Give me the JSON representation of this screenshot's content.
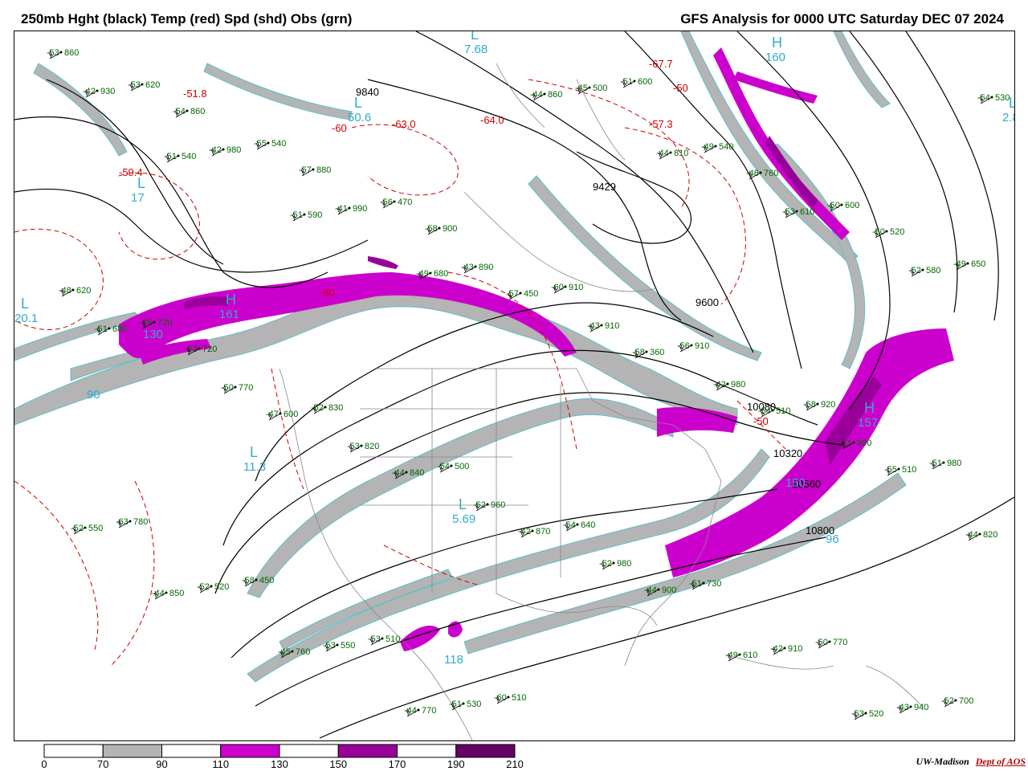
{
  "header": {
    "title_left": "250mb Hght (black) Temp (red) Spd (shd) Obs (grn)",
    "title_right": "GFS Analysis for 0000 UTC Saturday  DEC 07 2024"
  },
  "colors": {
    "gray_70_90": "#b4b4b4",
    "magenta_110_130": "#cc00cc",
    "purple_150_170": "#990099",
    "darkpurple_190_210": "#660066",
    "height_contour": "#000000",
    "temp_contour": "#cc0000",
    "obs": "#006600",
    "extrema": "#33aacc"
  },
  "colorbar": {
    "ticks": [
      "0",
      "70",
      "90",
      "110",
      "130",
      "150",
      "170",
      "190",
      "210"
    ],
    "fills": [
      "#ffffff",
      "#b4b4b4",
      "#ffffff",
      "#cc00cc",
      "#ffffff",
      "#990099",
      "#ffffff",
      "#660066"
    ]
  },
  "map": {
    "height_labels": [
      "9840",
      "9429",
      "9600",
      "10080",
      "10320",
      "10560",
      "10800"
    ],
    "temp_labels": [
      "-50",
      "-60",
      "-63.0",
      "-64.0",
      "-57.3",
      "-67.7",
      "-51.8",
      "-59.4",
      "-60",
      "-50"
    ],
    "extrema": [
      {
        "letter": "H",
        "value": "161"
      },
      {
        "letter": "H",
        "value": "157"
      },
      {
        "letter": "H",
        "value": "160"
      },
      {
        "letter": "L",
        "value": "7.68"
      },
      {
        "letter": "L",
        "value": "20.1"
      },
      {
        "letter": "L",
        "value": "11.3"
      },
      {
        "letter": "L",
        "value": "5.69"
      },
      {
        "letter": "L",
        "value": "2.8"
      },
      {
        "letter": "L",
        "value": "50.6"
      },
      {
        "letter": "L",
        "value": "17"
      },
      {
        "letter": "",
        "value": "90"
      },
      {
        "letter": "",
        "value": "130"
      },
      {
        "letter": "",
        "value": "150"
      },
      {
        "letter": "",
        "value": "118"
      },
      {
        "letter": "",
        "value": "96"
      }
    ],
    "obs": [
      {
        "t": "-53",
        "h": "860"
      },
      {
        "t": "-54",
        "h": "860"
      },
      {
        "t": "-57",
        "h": "880"
      },
      {
        "t": "-58",
        "h": "900"
      },
      {
        "t": "-60",
        "h": "910"
      },
      {
        "t": "-56",
        "h": "910"
      },
      {
        "t": "-58",
        "h": "920"
      },
      {
        "t": "-51",
        "h": "980"
      },
      {
        "t": "-63",
        "h": "780"
      },
      {
        "t": "-58",
        "h": "450"
      },
      {
        "t": "-53",
        "h": "510"
      },
      {
        "t": "-60",
        "h": "510"
      },
      {
        "t": "-51",
        "h": "600"
      },
      {
        "t": "-48",
        "h": "760"
      },
      {
        "t": "-50",
        "h": "520"
      },
      {
        "t": "-48",
        "h": "620"
      },
      {
        "t": "-53",
        "h": "720"
      },
      {
        "t": "-52",
        "h": "830"
      },
      {
        "t": "-54",
        "h": "500"
      },
      {
        "t": "-54",
        "h": "640"
      },
      {
        "t": "-51",
        "h": "730"
      },
      {
        "t": "-50",
        "h": "770"
      },
      {
        "t": "-52",
        "h": "700"
      },
      {
        "t": "-53",
        "h": "620"
      },
      {
        "t": "-55",
        "h": "540"
      },
      {
        "t": "-56",
        "h": "470"
      },
      {
        "t": "-57",
        "h": "450"
      },
      {
        "t": "-58",
        "h": "360"
      },
      {
        "t": "-54",
        "h": "510"
      },
      {
        "t": "-55",
        "h": "510"
      },
      {
        "t": "-52",
        "h": "550"
      },
      {
        "t": "-52",
        "h": "520"
      },
      {
        "t": "-53",
        "h": "550"
      },
      {
        "t": "-51",
        "h": "530"
      },
      {
        "t": "-45",
        "h": "500"
      },
      {
        "t": "-49",
        "h": "540"
      },
      {
        "t": "-50",
        "h": "600"
      },
      {
        "t": "-49",
        "h": "650"
      },
      {
        "t": "-46",
        "h": "720"
      },
      {
        "t": "-47",
        "h": "600"
      },
      {
        "t": "-44",
        "h": "840"
      },
      {
        "t": "-42",
        "h": "870"
      },
      {
        "t": "-44",
        "h": "900"
      },
      {
        "t": "-42",
        "h": "910"
      },
      {
        "t": "-43",
        "h": "940"
      },
      {
        "t": "-42",
        "h": "930"
      },
      {
        "t": "-42",
        "h": "980"
      },
      {
        "t": "-41",
        "h": "990"
      },
      {
        "t": "-43",
        "h": "890"
      },
      {
        "t": "-43",
        "h": "910"
      },
      {
        "t": "-42",
        "h": "980"
      },
      {
        "t": "-41",
        "h": "990"
      },
      {
        "t": "-44",
        "h": "820"
      },
      {
        "t": "-44",
        "h": "850"
      },
      {
        "t": "-45",
        "h": "760"
      },
      {
        "t": "-44",
        "h": "770"
      },
      {
        "t": "-44",
        "h": "860"
      },
      {
        "t": "-44",
        "h": "810"
      },
      {
        "t": "-53",
        "h": "610"
      },
      {
        "t": "-52",
        "h": "580"
      },
      {
        "t": "-51",
        "h": "680"
      },
      {
        "t": "-50",
        "h": "770"
      },
      {
        "t": "-53",
        "h": "820"
      },
      {
        "t": "-52",
        "h": "960"
      },
      {
        "t": "-52",
        "h": "980"
      },
      {
        "t": "-49",
        "h": "610"
      },
      {
        "t": "-53",
        "h": "520"
      },
      {
        "t": "-54",
        "h": "530"
      },
      {
        "t": "-51",
        "h": "540"
      },
      {
        "t": "-51",
        "h": "590"
      },
      {
        "t": "-49",
        "h": "680"
      }
    ]
  },
  "credit": {
    "org": "UW-Madison",
    "dept": "Dept of AOS"
  }
}
